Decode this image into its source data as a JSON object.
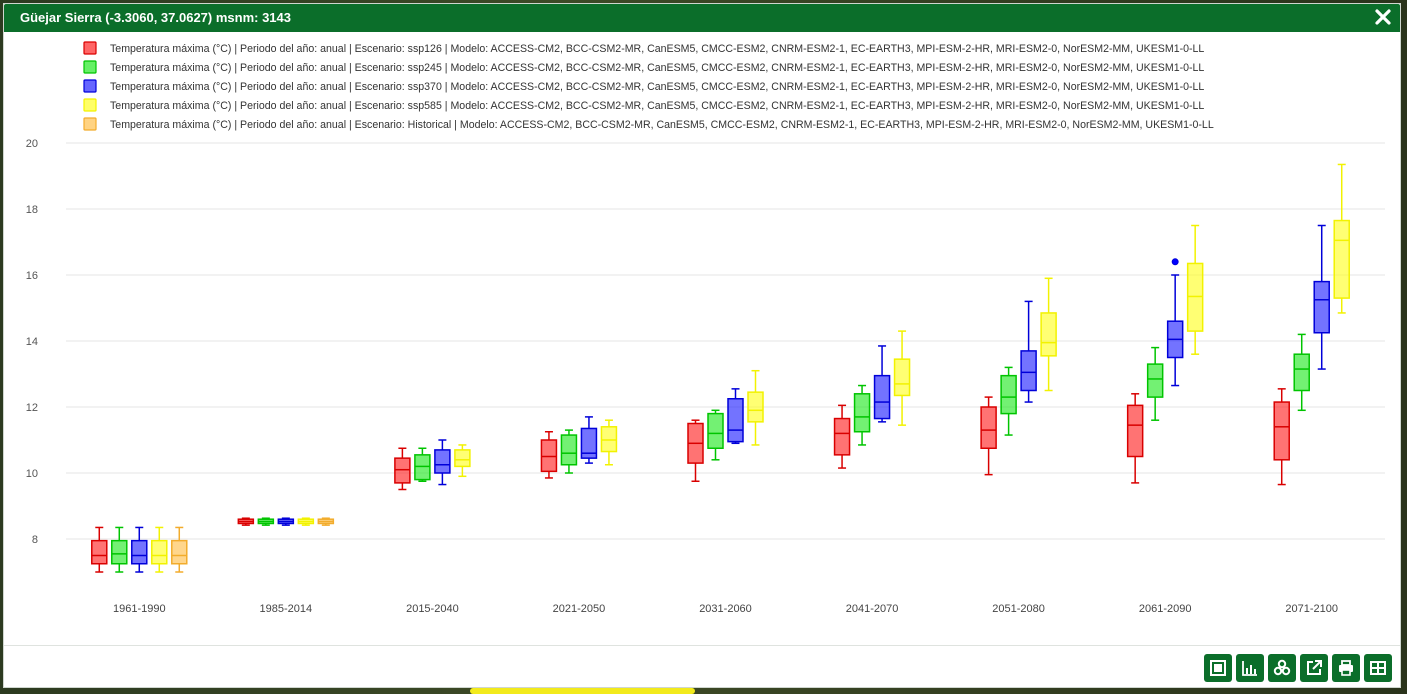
{
  "window": {
    "title": "Güejar Sierra (-3.3060, 37.0627) msnm: 3143",
    "close_icon": "close-icon"
  },
  "colors": {
    "header": "#0b6e2a",
    "ssp126": "#ff0000",
    "ssp245": "#00e600",
    "ssp370": "#0000ff",
    "ssp585": "#ffff00",
    "historical": "#ffb52e"
  },
  "toolbar": {
    "icons": [
      "screenshot-icon",
      "chart-icon",
      "hazard-icon",
      "external-link-icon",
      "print-icon",
      "table-icon"
    ]
  },
  "chart_data": {
    "type": "box",
    "ylim": [
      7,
      20
    ],
    "yticks": [
      8,
      10,
      12,
      14,
      16,
      18,
      20
    ],
    "grid": true,
    "legend_position": "top-left",
    "categories": [
      "1961-1990",
      "1985-2014",
      "2015-2040",
      "2021-2050",
      "2031-2060",
      "2041-2070",
      "2051-2080",
      "2061-2090",
      "2071-2100"
    ],
    "series": [
      {
        "name": "Temperatura máxima (°C) | Periodo del año: anual | Escenario: ssp126 | Modelo: ACCESS-CM2, BCC-CSM2-MR, CanESM5, CMCC-ESM2, CNRM-ESM2-1, EC-EARTH3, MPI-ESM-2-HR, MRI-ESM2-0, NorESM2-MM, UKESM1-0-LL",
        "color": "#ff0000",
        "boxes": [
          {
            "category": "1961-1990",
            "min": 7.0,
            "q1": 7.25,
            "median": 7.5,
            "q3": 7.95,
            "max": 8.35
          },
          {
            "category": "1985-2014",
            "min": 8.42,
            "q1": 8.47,
            "median": 8.53,
            "q3": 8.6,
            "max": 8.63
          },
          {
            "category": "2015-2040",
            "min": 9.5,
            "q1": 9.7,
            "median": 10.1,
            "q3": 10.45,
            "max": 10.75
          },
          {
            "category": "2021-2050",
            "min": 9.85,
            "q1": 10.05,
            "median": 10.5,
            "q3": 11.0,
            "max": 11.25
          },
          {
            "category": "2031-2060",
            "min": 9.75,
            "q1": 10.3,
            "median": 10.9,
            "q3": 11.5,
            "max": 11.6
          },
          {
            "category": "2041-2070",
            "min": 10.15,
            "q1": 10.55,
            "median": 11.2,
            "q3": 11.65,
            "max": 12.05
          },
          {
            "category": "2051-2080",
            "min": 9.95,
            "q1": 10.75,
            "median": 11.3,
            "q3": 12.0,
            "max": 12.3
          },
          {
            "category": "2061-2090",
            "min": 9.7,
            "q1": 10.5,
            "median": 11.45,
            "q3": 12.05,
            "max": 12.4
          },
          {
            "category": "2071-2100",
            "min": 9.65,
            "q1": 10.4,
            "median": 11.4,
            "q3": 12.15,
            "max": 12.55
          }
        ]
      },
      {
        "name": "Temperatura máxima (°C) | Periodo del año: anual | Escenario: ssp245 | Modelo: ACCESS-CM2, BCC-CSM2-MR, CanESM5, CMCC-ESM2, CNRM-ESM2-1, EC-EARTH3, MPI-ESM-2-HR, MRI-ESM2-0, NorESM2-MM, UKESM1-0-LL",
        "color": "#00e600",
        "boxes": [
          {
            "category": "1961-1990",
            "min": 7.0,
            "q1": 7.25,
            "median": 7.55,
            "q3": 7.95,
            "max": 8.35
          },
          {
            "category": "1985-2014",
            "min": 8.42,
            "q1": 8.47,
            "median": 8.53,
            "q3": 8.6,
            "max": 8.63
          },
          {
            "category": "2015-2040",
            "min": 9.75,
            "q1": 9.8,
            "median": 10.2,
            "q3": 10.55,
            "max": 10.75
          },
          {
            "category": "2021-2050",
            "min": 10.0,
            "q1": 10.25,
            "median": 10.6,
            "q3": 11.15,
            "max": 11.3
          },
          {
            "category": "2031-2060",
            "min": 10.4,
            "q1": 10.75,
            "median": 11.2,
            "q3": 11.8,
            "max": 11.9
          },
          {
            "category": "2041-2070",
            "min": 10.85,
            "q1": 11.25,
            "median": 11.7,
            "q3": 12.4,
            "max": 12.65
          },
          {
            "category": "2051-2080",
            "min": 11.15,
            "q1": 11.8,
            "median": 12.3,
            "q3": 12.95,
            "max": 13.2
          },
          {
            "category": "2061-2090",
            "min": 11.6,
            "q1": 12.3,
            "median": 12.85,
            "q3": 13.3,
            "max": 13.8
          },
          {
            "category": "2071-2100",
            "min": 11.9,
            "q1": 12.5,
            "median": 13.15,
            "q3": 13.6,
            "max": 14.2
          }
        ]
      },
      {
        "name": "Temperatura máxima (°C) | Periodo del año: anual | Escenario: ssp370 | Modelo: ACCESS-CM2, BCC-CSM2-MR, CanESM5, CMCC-ESM2, CNRM-ESM2-1, EC-EARTH3, MPI-ESM-2-HR, MRI-ESM2-0, NorESM2-MM, UKESM1-0-LL",
        "color": "#0000ff",
        "boxes": [
          {
            "category": "1961-1990",
            "min": 7.0,
            "q1": 7.25,
            "median": 7.5,
            "q3": 7.95,
            "max": 8.35
          },
          {
            "category": "1985-2014",
            "min": 8.42,
            "q1": 8.47,
            "median": 8.53,
            "q3": 8.6,
            "max": 8.63
          },
          {
            "category": "2015-2040",
            "min": 9.65,
            "q1": 10.0,
            "median": 10.25,
            "q3": 10.7,
            "max": 11.0
          },
          {
            "category": "2021-2050",
            "min": 10.3,
            "q1": 10.45,
            "median": 10.6,
            "q3": 11.35,
            "max": 11.7
          },
          {
            "category": "2031-2060",
            "min": 10.9,
            "q1": 10.95,
            "median": 11.3,
            "q3": 12.25,
            "max": 12.55
          },
          {
            "category": "2041-2070",
            "min": 11.55,
            "q1": 11.65,
            "median": 12.15,
            "q3": 12.95,
            "max": 13.85
          },
          {
            "category": "2051-2080",
            "min": 12.15,
            "q1": 12.5,
            "median": 13.05,
            "q3": 13.7,
            "max": 15.2
          },
          {
            "category": "2061-2090",
            "min": 12.65,
            "q1": 13.5,
            "median": 14.05,
            "q3": 14.6,
            "max": 16.0,
            "outliers": [
              16.4
            ]
          },
          {
            "category": "2071-2100",
            "min": 13.15,
            "q1": 14.25,
            "median": 15.25,
            "q3": 15.8,
            "max": 17.5
          }
        ]
      },
      {
        "name": "Temperatura máxima (°C) | Periodo del año: anual | Escenario: ssp585 | Modelo: ACCESS-CM2, BCC-CSM2-MR, CanESM5, CMCC-ESM2, CNRM-ESM2-1, EC-EARTH3, MPI-ESM-2-HR, MRI-ESM2-0, NorESM2-MM, UKESM1-0-LL",
        "color": "#ffff00",
        "boxes": [
          {
            "category": "1961-1990",
            "min": 7.0,
            "q1": 7.25,
            "median": 7.5,
            "q3": 7.95,
            "max": 8.35
          },
          {
            "category": "1985-2014",
            "min": 8.42,
            "q1": 8.47,
            "median": 8.53,
            "q3": 8.6,
            "max": 8.63
          },
          {
            "category": "2015-2040",
            "min": 9.9,
            "q1": 10.2,
            "median": 10.4,
            "q3": 10.7,
            "max": 10.85
          },
          {
            "category": "2021-2050",
            "min": 10.25,
            "q1": 10.65,
            "median": 11.0,
            "q3": 11.4,
            "max": 11.6
          },
          {
            "category": "2031-2060",
            "min": 10.85,
            "q1": 11.55,
            "median": 11.9,
            "q3": 12.45,
            "max": 13.1
          },
          {
            "category": "2041-2070",
            "min": 11.45,
            "q1": 12.35,
            "median": 12.7,
            "q3": 13.45,
            "max": 14.3
          },
          {
            "category": "2051-2080",
            "min": 12.5,
            "q1": 13.55,
            "median": 13.95,
            "q3": 14.85,
            "max": 15.9
          },
          {
            "category": "2061-2090",
            "min": 13.6,
            "q1": 14.3,
            "median": 15.35,
            "q3": 16.35,
            "max": 17.5
          },
          {
            "category": "2071-2100",
            "min": 14.85,
            "q1": 15.3,
            "median": 17.05,
            "q3": 17.65,
            "max": 19.35
          }
        ]
      },
      {
        "name": "Temperatura máxima (°C) | Periodo del año: anual | Escenario: Historical | Modelo: ACCESS-CM2, BCC-CSM2-MR, CanESM5, CMCC-ESM2, CNRM-ESM2-1, EC-EARTH3, MPI-ESM-2-HR, MRI-ESM2-0, NorESM2-MM, UKESM1-0-LL",
        "color": "#ffb52e",
        "boxes": [
          {
            "category": "1961-1990",
            "min": 7.0,
            "q1": 7.25,
            "median": 7.5,
            "q3": 7.95,
            "max": 8.35
          },
          {
            "category": "1985-2014",
            "min": 8.42,
            "q1": 8.47,
            "median": 8.53,
            "q3": 8.6,
            "max": 8.63
          }
        ]
      }
    ]
  }
}
